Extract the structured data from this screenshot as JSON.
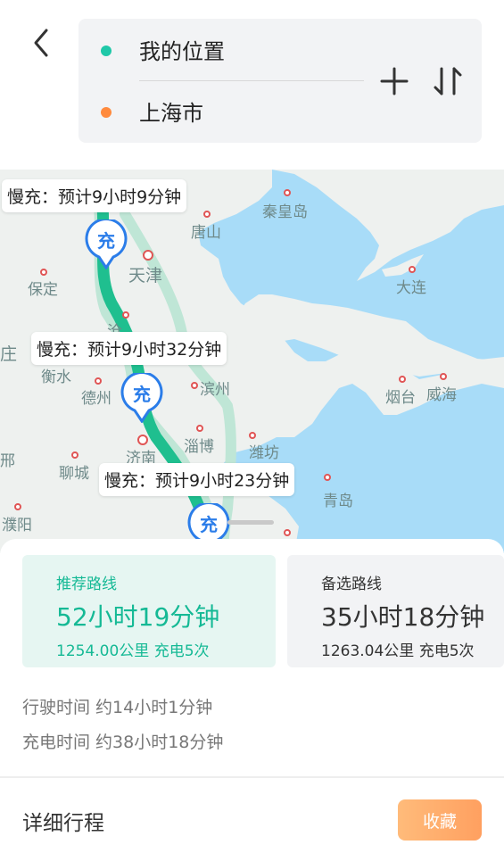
{
  "header": {
    "origin": "我的位置",
    "destination": "上海市",
    "icons": {
      "back": "back-arrow-icon",
      "add": "plus-icon",
      "swap": "swap-icon"
    }
  },
  "map": {
    "cities": [
      "秦皇岛",
      "唐山",
      "天津",
      "保定",
      "大连",
      "沧",
      "庄",
      "衡水",
      "德州",
      "滨州",
      "烟台",
      "威海",
      "淄博",
      "潍坊",
      "济南",
      "邢",
      "聊城",
      "青岛",
      "濮阳"
    ],
    "charge_marker": "充",
    "bubbles": [
      "慢充：预计9小时9分钟",
      "慢充：预计9小时32分钟",
      "慢充：预计9小时23分钟"
    ]
  },
  "routes": {
    "primary": {
      "label": "推荐路线",
      "time": "52小时19分钟",
      "summary": "1254.00公里  充电5次"
    },
    "alt": {
      "label": "备选路线",
      "time": "35小时18分钟",
      "summary": "1263.04公里  充电5次"
    }
  },
  "info": {
    "drive": "行驶时间 约14小时1分钟",
    "charge": "充电时间 约38小时18分钟"
  },
  "footer": {
    "detail": "详细行程",
    "favorite": "收藏"
  },
  "colors": {
    "accent": "#15b995",
    "route": "#1fbf8f",
    "alt_route": "#bfe6d6",
    "sea": "#a8dcf8",
    "favorite": "#ffa868"
  }
}
